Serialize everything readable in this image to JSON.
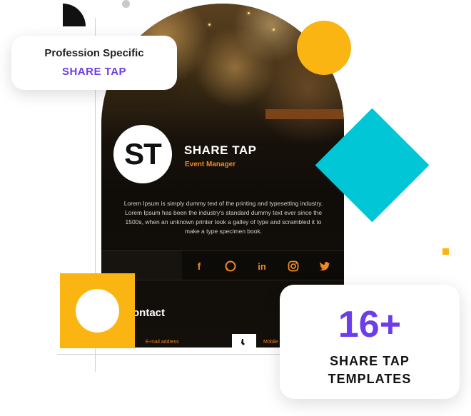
{
  "badge_left": {
    "line1": "Profession Specific",
    "line2": "SHARE TAP"
  },
  "card": {
    "logo_text": "ST",
    "name": "SHARE TAP",
    "role": "Event Manager",
    "description": "Lorem Ipsum is simply dummy text of the printing and typesetting industry. Lorem Ipsum has been the industry's standard dummy text ever since the 1500s, when an unknown printer took a galley of type and scrambled it to make a type specimen book.",
    "social_icons": [
      "facebook-icon",
      "whatsapp-icon",
      "linkedin-icon",
      "instagram-icon",
      "twitter-icon"
    ],
    "contact_title": "ontact",
    "email_label": "E-mail address",
    "mobile_label": "Mobile"
  },
  "badge_right": {
    "count": "16+",
    "line1": "SHARE TAP",
    "line2": "TEMPLATES"
  },
  "colors": {
    "accent_purple": "#6c3de8",
    "accent_orange": "#f28a1c",
    "yellow": "#fbb513",
    "teal": "#00c6d6"
  }
}
